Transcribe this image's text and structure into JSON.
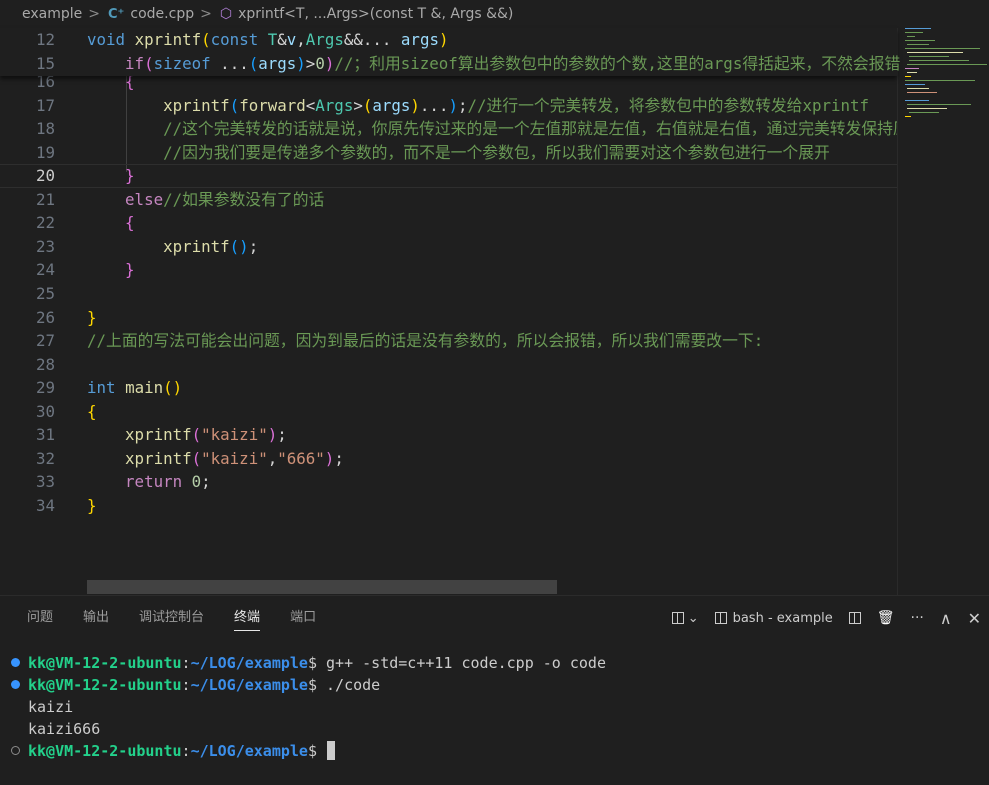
{
  "breadcrumb": {
    "folder": "example",
    "file": "code.cpp",
    "symbol": "xprintf<T, ...Args>(const T &, Args &&)"
  },
  "icons": {
    "cpp": "C⁺",
    "method": "⬡",
    "chevron": ">"
  },
  "editor": {
    "current_line": 20,
    "sticky": [
      {
        "n": "12",
        "tokens": [
          [
            "kw",
            "void"
          ],
          [
            "tx",
            " "
          ],
          [
            "fn",
            "xprintf"
          ],
          [
            "b1",
            "("
          ],
          [
            "kw",
            "const"
          ],
          [
            "tx",
            " "
          ],
          [
            "ty",
            "T"
          ],
          [
            "tx",
            "&"
          ],
          [
            "pa",
            "v"
          ],
          [
            "tx",
            ","
          ],
          [
            "ty",
            "Args"
          ],
          [
            "tx",
            "&&"
          ],
          [
            "tx",
            "... "
          ],
          [
            "pa",
            "args"
          ],
          [
            "b1",
            ")"
          ]
        ]
      },
      {
        "n": "15",
        "tokens": [
          [
            "tx",
            "    "
          ],
          [
            "ct",
            "if"
          ],
          [
            "b2",
            "("
          ],
          [
            "kw",
            "sizeof"
          ],
          [
            "tx",
            " ..."
          ],
          [
            "b3",
            "("
          ],
          [
            "pa",
            "args"
          ],
          [
            "b3",
            ")"
          ],
          [
            "tx",
            ">"
          ],
          [
            "nu",
            "0"
          ],
          [
            "b2",
            ")"
          ],
          [
            "cm",
            "//；利用sizeof算出参数包中的参数的个数,这里的args得括起来，不然会报错"
          ]
        ]
      }
    ],
    "lines": [
      {
        "n": "16",
        "tokens": [
          [
            "tx",
            "    "
          ],
          [
            "b2",
            "{"
          ]
        ]
      },
      {
        "n": "17",
        "tokens": [
          [
            "tx",
            "        "
          ],
          [
            "fn",
            "xprintf"
          ],
          [
            "b3",
            "("
          ],
          [
            "fn",
            "forward"
          ],
          [
            "tx",
            "<"
          ],
          [
            "ty",
            "Args"
          ],
          [
            "tx",
            ">"
          ],
          [
            "b1",
            "("
          ],
          [
            "pa",
            "args"
          ],
          [
            "b1",
            ")"
          ],
          [
            "tx",
            "..."
          ],
          [
            "b3",
            ")"
          ],
          [
            "tx",
            ";"
          ],
          [
            "cm",
            "//进行一个完美转发，将参数包中的参数转发给xprintf"
          ]
        ]
      },
      {
        "n": "18",
        "tokens": [
          [
            "tx",
            "        "
          ],
          [
            "cm",
            "//这个完美转发的话就是说，你原先传过来的是一个左值那就是左值，右值就是右值，通过完美转发保持原来的属性"
          ]
        ]
      },
      {
        "n": "19",
        "tokens": [
          [
            "tx",
            "        "
          ],
          [
            "cm",
            "//因为我们要是传递多个参数的，而不是一个参数包，所以我们需要对这个参数包进行一个展开"
          ]
        ]
      },
      {
        "n": "20",
        "tokens": [
          [
            "tx",
            "    "
          ],
          [
            "b2",
            "}"
          ]
        ]
      },
      {
        "n": "21",
        "tokens": [
          [
            "tx",
            "    "
          ],
          [
            "ct",
            "else"
          ],
          [
            "cm",
            "//如果参数没有了的话"
          ]
        ]
      },
      {
        "n": "22",
        "tokens": [
          [
            "tx",
            "    "
          ],
          [
            "b2",
            "{"
          ]
        ]
      },
      {
        "n": "23",
        "tokens": [
          [
            "tx",
            "        "
          ],
          [
            "fn",
            "xprintf"
          ],
          [
            "b3",
            "()"
          ],
          [
            "tx",
            ";"
          ]
        ]
      },
      {
        "n": "24",
        "tokens": [
          [
            "tx",
            "    "
          ],
          [
            "b2",
            "}"
          ]
        ]
      },
      {
        "n": "25",
        "tokens": []
      },
      {
        "n": "26",
        "tokens": [
          [
            "b1",
            "}"
          ]
        ]
      },
      {
        "n": "27",
        "tokens": [
          [
            "cm",
            "//上面的写法可能会出问题，因为到最后的话是没有参数的，所以会报错，所以我们需要改一下:"
          ]
        ]
      },
      {
        "n": "28",
        "tokens": []
      },
      {
        "n": "29",
        "tokens": [
          [
            "kw",
            "int"
          ],
          [
            "tx",
            " "
          ],
          [
            "fn",
            "main"
          ],
          [
            "b1",
            "()"
          ]
        ]
      },
      {
        "n": "30",
        "tokens": [
          [
            "b1",
            "{"
          ]
        ]
      },
      {
        "n": "31",
        "tokens": [
          [
            "tx",
            "    "
          ],
          [
            "fn",
            "xprintf"
          ],
          [
            "b2",
            "("
          ],
          [
            "st",
            "\"kaizi\""
          ],
          [
            "b2",
            ")"
          ],
          [
            "tx",
            ";"
          ]
        ]
      },
      {
        "n": "32",
        "tokens": [
          [
            "tx",
            "    "
          ],
          [
            "fn",
            "xprintf"
          ],
          [
            "b2",
            "("
          ],
          [
            "st",
            "\"kaizi\""
          ],
          [
            "tx",
            ","
          ],
          [
            "st",
            "\"666\""
          ],
          [
            "b2",
            ")"
          ],
          [
            "tx",
            ";"
          ]
        ]
      },
      {
        "n": "33",
        "tokens": [
          [
            "tx",
            "    "
          ],
          [
            "ct",
            "return"
          ],
          [
            "tx",
            " "
          ],
          [
            "nu",
            "0"
          ],
          [
            "tx",
            ";"
          ]
        ]
      },
      {
        "n": "34",
        "tokens": [
          [
            "b1",
            "}"
          ]
        ]
      }
    ]
  },
  "panel": {
    "tabs": [
      "问题",
      "输出",
      "调试控制台",
      "终端",
      "端口"
    ],
    "active_tab": "终端",
    "terminal_name": "bash - example",
    "actions": {
      "chevron_down": "⌄",
      "trash": "🗑",
      "more": "···",
      "maximize": "∧",
      "close": "✕"
    }
  },
  "terminal": {
    "user_host": "kk@VM-12-2-ubuntu",
    "path": "~/LOG/example",
    "lines": [
      {
        "type": "cmd",
        "status": "success",
        "cmd": "g++ -std=c++11 code.cpp -o code"
      },
      {
        "type": "cmd",
        "status": "success",
        "cmd": "./code"
      },
      {
        "type": "out",
        "text": "kaizi"
      },
      {
        "type": "out",
        "text": "kaizi666"
      },
      {
        "type": "cmd",
        "status": "idle",
        "cmd": ""
      }
    ]
  }
}
